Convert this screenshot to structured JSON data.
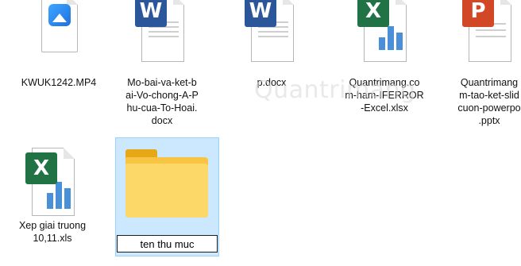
{
  "files": [
    {
      "name": "KWUK1242.MP4",
      "type": "video",
      "icon": "video-file-icon"
    },
    {
      "name": "Mo-bai-va-ket-b\nai-Vo-chong-A-P\nhu-cua-To-Hoai.\ndocx",
      "type": "word",
      "icon": "word-document-icon"
    },
    {
      "name": "p.docx",
      "type": "word",
      "icon": "word-document-icon"
    },
    {
      "name": "Quantrimang.co\nm-ham-IFERROR\n-Excel.xlsx",
      "type": "excel",
      "icon": "excel-spreadsheet-icon"
    },
    {
      "name": "Quantrimang\nm-tao-ket-slid\ncuon-powerpo\n.pptx",
      "type": "powerpoint",
      "icon": "powerpoint-presentation-icon"
    },
    {
      "name": "Xep giai truong\n10,11.xls",
      "type": "excel",
      "icon": "excel-spreadsheet-icon"
    }
  ],
  "new_folder": {
    "rename_value": "ten thu muc",
    "icon": "folder-icon",
    "state": "renaming"
  },
  "watermark": "Quantrimang",
  "colors": {
    "word": "#2b579a",
    "excel": "#217346",
    "powerpoint": "#d24726",
    "folder": "#f8c542",
    "selection": "#cce8ff",
    "selection_border": "#99d1ff"
  }
}
